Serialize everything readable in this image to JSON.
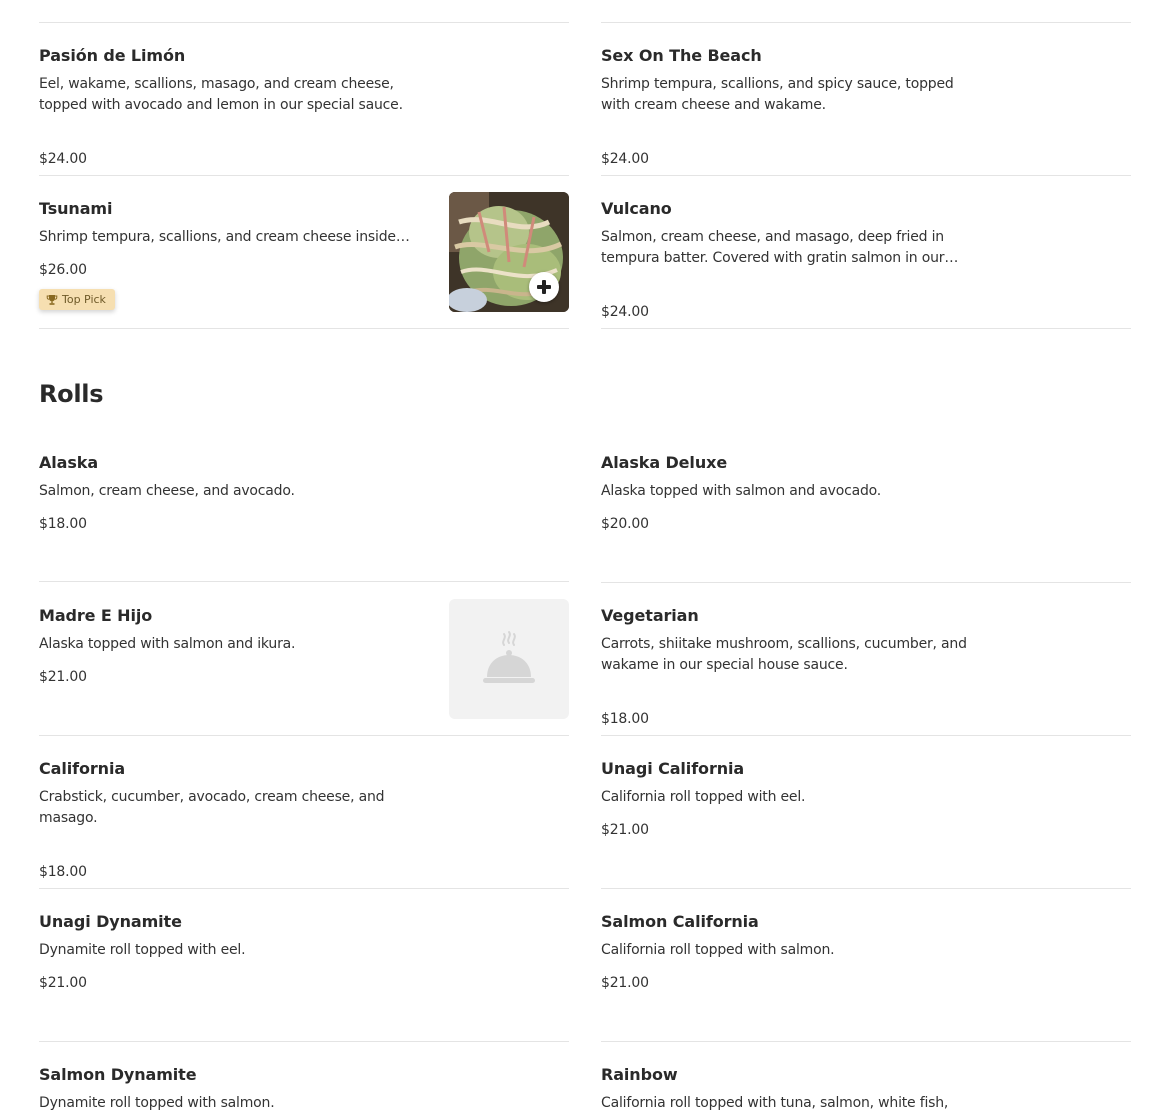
{
  "items": [
    {
      "name": "Pasión de Limón",
      "description": "Eel, wakame, scallions, masago, and cream cheese, topped with avocado and lemon in our special sauce.",
      "price": "$24.00"
    },
    {
      "name": "Sex On The Beach",
      "description": "Shrimp tempura, scallions, and spicy sauce, topped with cream cheese and wakame.",
      "price": "$24.00"
    },
    {
      "name": "Tsunami",
      "description": "Shrimp tempura, scallions, and cream cheese inside, topped with crab.",
      "price": "$26.00",
      "badge": "Top Pick"
    },
    {
      "name": "Vulcano",
      "description": "Salmon, cream cheese, and masago, deep fried in tempura batter. Covered with gratin salmon in our special sauce.",
      "price": "$24.00"
    }
  ],
  "rolls": {
    "title": "Rolls",
    "items": [
      {
        "name": "Alaska",
        "description": "Salmon, cream cheese, and avocado.",
        "price": "$18.00"
      },
      {
        "name": "Alaska Deluxe",
        "description": "Alaska topped with salmon and avocado.",
        "price": "$20.00"
      },
      {
        "name": "Madre E Hijo",
        "description": "Alaska topped with salmon and ikura.",
        "price": "$21.00"
      },
      {
        "name": "Vegetarian",
        "description": "Carrots, shiitake mushroom, scallions, cucumber, and wakame in our special house sauce.",
        "price": "$18.00"
      },
      {
        "name": "California",
        "description": "Crabstick, cucumber, avocado, cream cheese, and masago.",
        "price": "$18.00"
      },
      {
        "name": "Unagi California",
        "description": "California roll topped with eel.",
        "price": "$21.00"
      },
      {
        "name": "Unagi Dynamite",
        "description": "Dynamite roll topped with eel.",
        "price": "$21.00"
      },
      {
        "name": "Salmon California",
        "description": "California roll topped with salmon.",
        "price": "$21.00"
      },
      {
        "name": "Salmon Dynamite",
        "description": "Dynamite roll topped with salmon.",
        "price": ""
      },
      {
        "name": "Rainbow",
        "description": "California roll topped with tuna, salmon, white fish,",
        "price": ""
      }
    ]
  },
  "icons": {
    "add": "plus-icon",
    "trophy": "trophy-icon",
    "placeholder": "dish-cloche-icon"
  },
  "colors": {
    "badge_bg": "#f6dfb1",
    "text": "#2a2a2a",
    "divider": "#e4e4e4"
  }
}
